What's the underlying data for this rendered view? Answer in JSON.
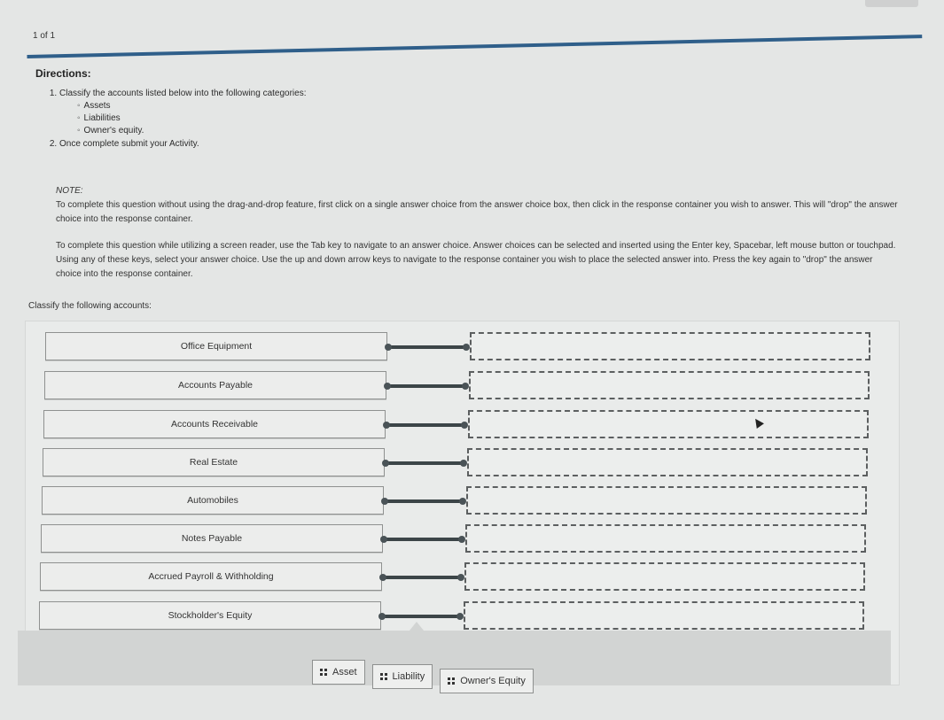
{
  "header": {
    "page_indicator": "1 of 1"
  },
  "directions": {
    "title": "Directions:",
    "steps": [
      "Classify the accounts listed below into the following categories:",
      "Once complete submit your Activity."
    ],
    "categories": [
      "Assets",
      "Liabilities",
      "Owner's equity."
    ]
  },
  "note": {
    "label": "NOTE:",
    "paragraph1": "To complete this question without using the drag-and-drop feature, first click on a single answer choice from the answer choice box, then click in the response container you wish to answer. This will \"drop\" the answer choice into the response container.",
    "paragraph2": "To complete this question while utilizing a screen reader, use the Tab key to navigate to an answer choice. Answer choices can be selected and inserted using the Enter key, Spacebar, left mouse button or touchpad. Using any of these keys, select your answer choice. Use the up and down arrow keys to navigate to the response container you wish to place the selected answer into. Press the key again to \"drop\" the answer choice into the response container."
  },
  "activity": {
    "prompt": "Classify the following accounts:",
    "accounts": [
      {
        "label": "Office Equipment",
        "answer": ""
      },
      {
        "label": "Accounts Payable",
        "answer": ""
      },
      {
        "label": "Accounts Receivable",
        "answer": ""
      },
      {
        "label": "Real Estate",
        "answer": ""
      },
      {
        "label": "Automobiles",
        "answer": ""
      },
      {
        "label": "Notes Payable",
        "answer": ""
      },
      {
        "label": "Accrued Payroll & Withholding",
        "answer": ""
      },
      {
        "label": "Stockholder's Equity",
        "answer": ""
      }
    ],
    "answer_choices": [
      "Asset",
      "Liability",
      "Owner's Equity"
    ]
  }
}
